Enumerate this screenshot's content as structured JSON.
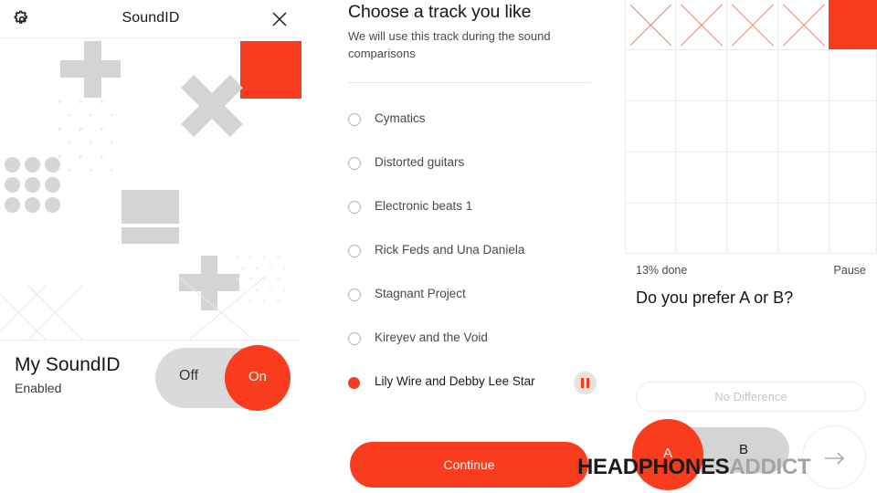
{
  "brand": {
    "red": "#fa3c1e",
    "gray": "#d4d4d4",
    "light_gray": "#ededed"
  },
  "panel1": {
    "header": {
      "title": "SoundID",
      "gear_icon": "gear-icon",
      "close_icon": "close-icon"
    },
    "footer": {
      "title": "My SoundID",
      "status": "Enabled",
      "toggle_off_label": "Off",
      "toggle_on_label": "On",
      "toggle_state": "On"
    }
  },
  "panel2": {
    "title": "Choose a track you like",
    "subtitle": "We will use this track during the sound comparisons",
    "tracks": [
      {
        "label": "Cymatics",
        "selected": false
      },
      {
        "label": "Distorted guitars",
        "selected": false
      },
      {
        "label": "Electronic beats 1",
        "selected": false
      },
      {
        "label": "Rick Feds and Una Daniela",
        "selected": false
      },
      {
        "label": "Stagnant Project",
        "selected": false
      },
      {
        "label": "Kireyev and the Void",
        "selected": false
      },
      {
        "label": "Lily Wire and Debby Lee Star",
        "selected": true
      }
    ],
    "pause_icon": "pause-icon",
    "continue_label": "Continue"
  },
  "panel3": {
    "progress_label": "13% done",
    "pause_label": "Pause",
    "question": "Do you prefer A or B?",
    "no_difference_label": "No Difference",
    "ab_a_label": "A",
    "ab_b_label": "B",
    "ab_selected": "A",
    "next_icon": "arrow-right-icon"
  },
  "watermark": {
    "bold": "HEADPHONES",
    "light": "ADDICT"
  }
}
